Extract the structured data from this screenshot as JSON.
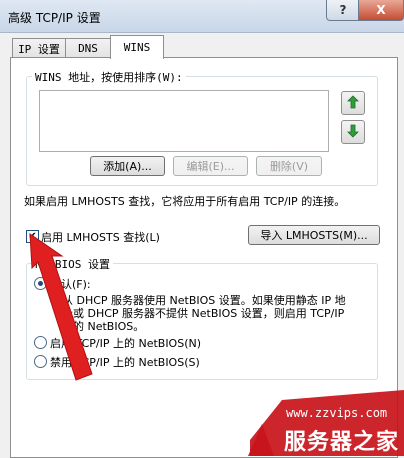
{
  "window": {
    "title": "高级 TCP/IP 设置",
    "help_label": "?",
    "close_label": "X"
  },
  "tabs": [
    {
      "label": "IP 设置"
    },
    {
      "label": "DNS"
    },
    {
      "label": "WINS"
    }
  ],
  "wins": {
    "group_label": "WINS 地址，按使用排序(W):",
    "up_icon": "green-up-arrow-icon",
    "down_icon": "green-down-arrow-icon",
    "add_label": "添加(A)...",
    "edit_label": "编辑(E)...",
    "delete_label": "删除(V)"
  },
  "lmhosts": {
    "note": "如果启用 LMHOSTS 查找，它将应用于所有启用 TCP/IP 的连接。",
    "checkbox_label": "启用 LMHOSTS 查找(L)",
    "checked": true,
    "import_label": "导入 LMHOSTS(M)..."
  },
  "netbios": {
    "group_label": "NetBIOS 设置",
    "options": [
      {
        "label": "默认(F):",
        "selected": true
      },
      {
        "label": "启用 TCP/IP 上的 NetBIOS(N)",
        "selected": false
      },
      {
        "label": "禁用 TCP/IP 上的 NetBIOS(S)",
        "selected": false
      }
    ],
    "default_description_line1": "从 DHCP 服务器使用 NetBIOS 设置。如果使用静态 IP 地",
    "default_description_line2": "址或 DHCP 服务器不提供 NetBIOS 设置，则启用 TCP/IP",
    "default_description_line3": "上的 NetBIOS。"
  },
  "watermark": {
    "url": "www.zzvips.com",
    "name": "服务器之家"
  },
  "colors": {
    "annotation_arrow": "#e02020",
    "accent_blue": "#1a4f8a"
  }
}
